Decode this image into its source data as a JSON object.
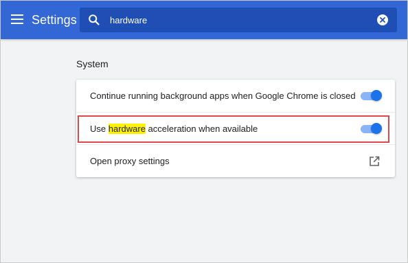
{
  "header": {
    "title": "Settings",
    "menu_icon": "hamburger-menu-icon",
    "search": {
      "value": "hardware",
      "placeholder": "Search settings",
      "search_icon": "search-icon",
      "clear_icon": "clear-search-icon"
    }
  },
  "section": {
    "title": "System",
    "rows": [
      {
        "label": "Continue running background apps when Google Chrome is closed",
        "control": "toggle",
        "checked": true
      },
      {
        "label_before": "Use ",
        "label_highlight": "hardware",
        "label_after": " acceleration when available",
        "control": "toggle",
        "checked": true
      },
      {
        "label": "Open proxy settings",
        "control": "launch",
        "icon": "open-in-new-icon"
      }
    ]
  },
  "colors": {
    "topbar": "#3367d6",
    "search_background": "#1f4fb4",
    "page_background": "#f1f3f4",
    "toggle_track": "#8ab4f8",
    "toggle_knob": "#1a73e8",
    "text_highlight": "#fff200",
    "annotation_box": "#e0474c"
  }
}
